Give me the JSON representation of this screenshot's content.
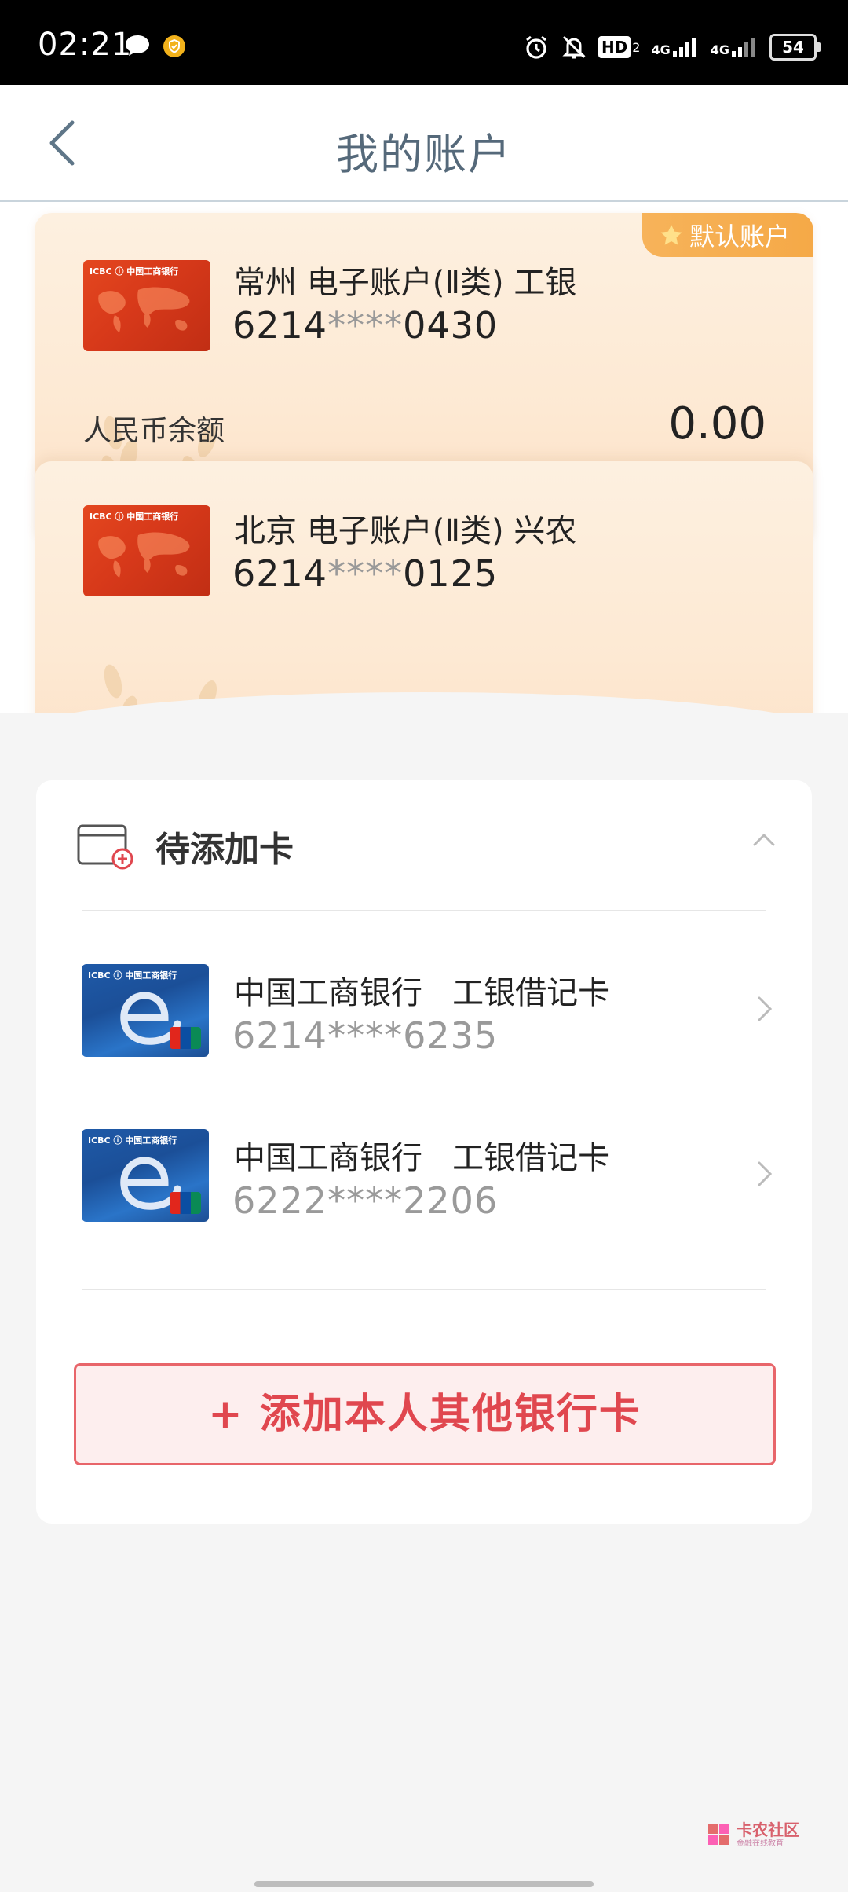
{
  "status_bar": {
    "time": "02:21",
    "network_hd": "HD",
    "network_hd_sub": "2",
    "network_4g_1": "4G",
    "network_4g_2": "4G",
    "battery": "54"
  },
  "nav": {
    "title": "我的账户"
  },
  "accounts": [
    {
      "name": "常州 电子账户(Ⅱ类) 工银",
      "num_prefix": "6214",
      "num_mask": "****",
      "num_suffix": "0430",
      "default_tag": "默认账户",
      "balance_label": "人民币余额",
      "balance_value": "0.00"
    },
    {
      "name": "北京 电子账户(Ⅱ类) 兴农",
      "num_prefix": "6214",
      "num_mask": "****",
      "num_suffix": "0125"
    }
  ],
  "pending": {
    "title": "待添加卡",
    "cards": [
      {
        "name": "中国工商银行   工银借记卡",
        "number": "6214****6235"
      },
      {
        "name": "中国工商银行   工银借记卡",
        "number": "6222****2206"
      }
    ],
    "add_button": "+ 添加本人其他银行卡"
  },
  "card_thumb_logo": "ICBC ⓘ 中国工商银行",
  "watermark": {
    "main": "卡农社区",
    "sub": "金融在线教育"
  },
  "colors": {
    "accent_red": "#e0474f",
    "default_tag": "#f5a947",
    "nav_title": "#55697a"
  }
}
